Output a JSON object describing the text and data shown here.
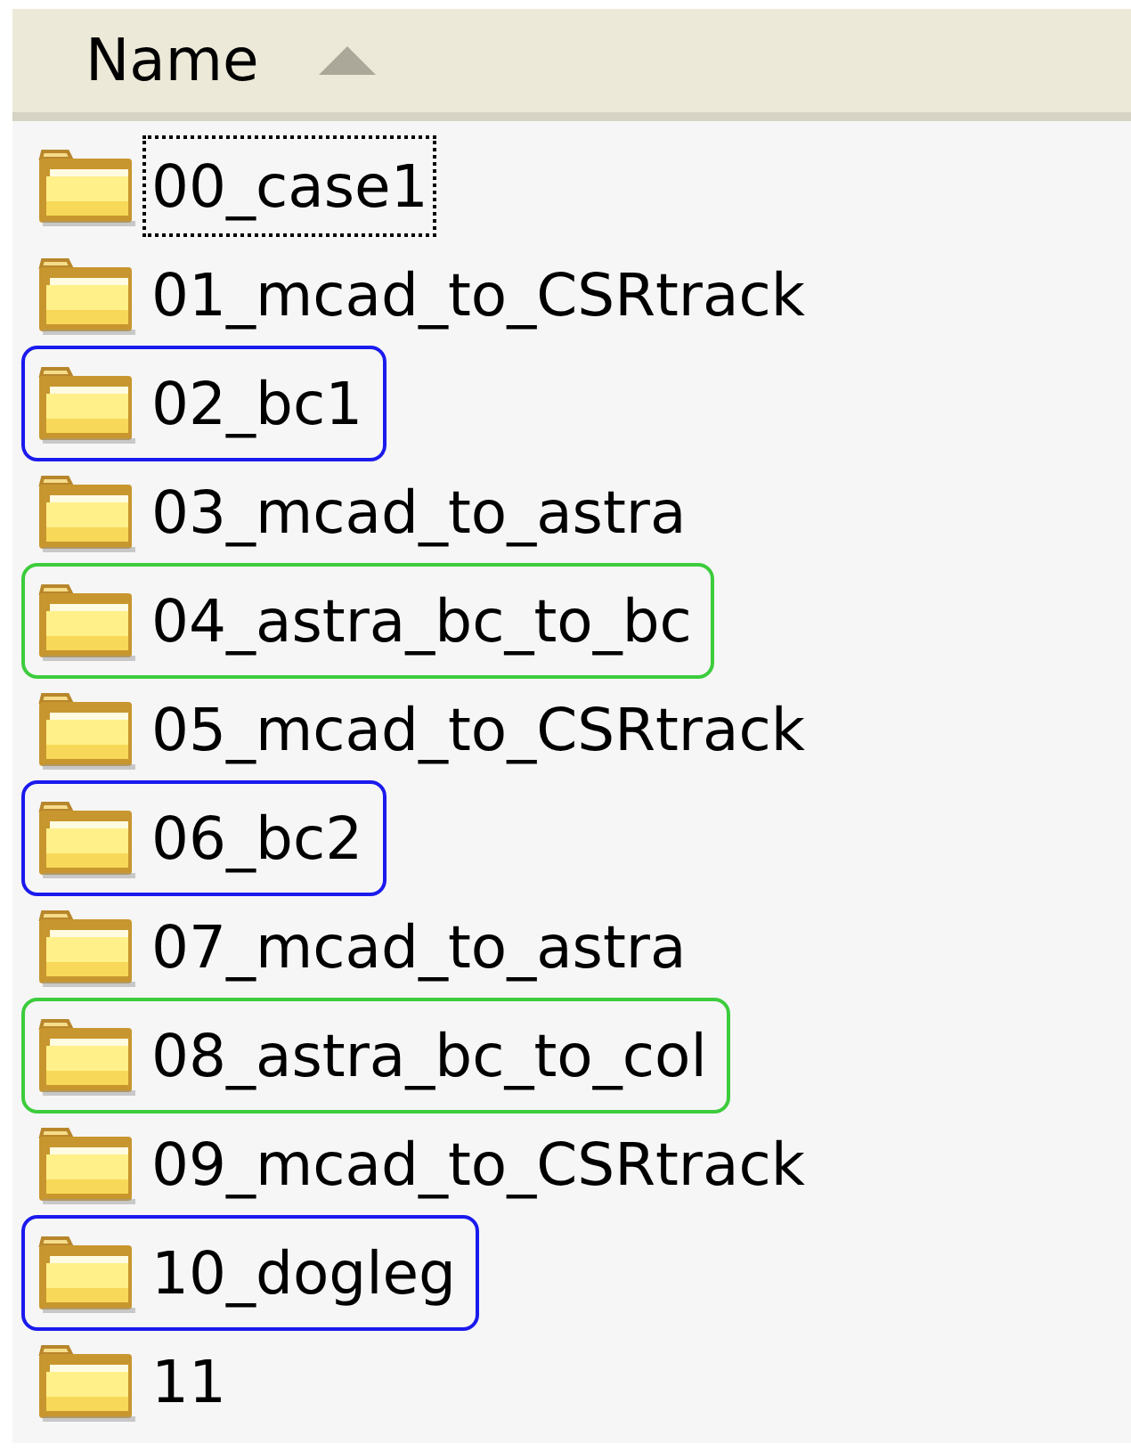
{
  "header": {
    "column": "Name",
    "sorted": true
  },
  "folders": [
    {
      "name": "00_case1",
      "focused": true
    },
    {
      "name": "01_mcad_to_CSRtrack",
      "focused": false
    },
    {
      "name": "02_bc1",
      "focused": false,
      "color": "#1a1aee"
    },
    {
      "name": "03_mcad_to_astra",
      "focused": false
    },
    {
      "name": "04_astra_bc_to_bc",
      "focused": false,
      "color": "#3ccc3c"
    },
    {
      "name": "05_mcad_to_CSRtrack",
      "focused": false
    },
    {
      "name": "06_bc2",
      "focused": false,
      "color": "#1a1aee"
    },
    {
      "name": "07_mcad_to_astra",
      "focused": false
    },
    {
      "name": "08_astra_bc_to_col",
      "focused": false,
      "color": "#3ccc3c"
    },
    {
      "name": "09_mcad_to_CSRtrack",
      "focused": false
    },
    {
      "name": "10_dogleg",
      "focused": false,
      "color": "#1a1aee"
    },
    {
      "name": "11",
      "focused": false
    }
  ]
}
